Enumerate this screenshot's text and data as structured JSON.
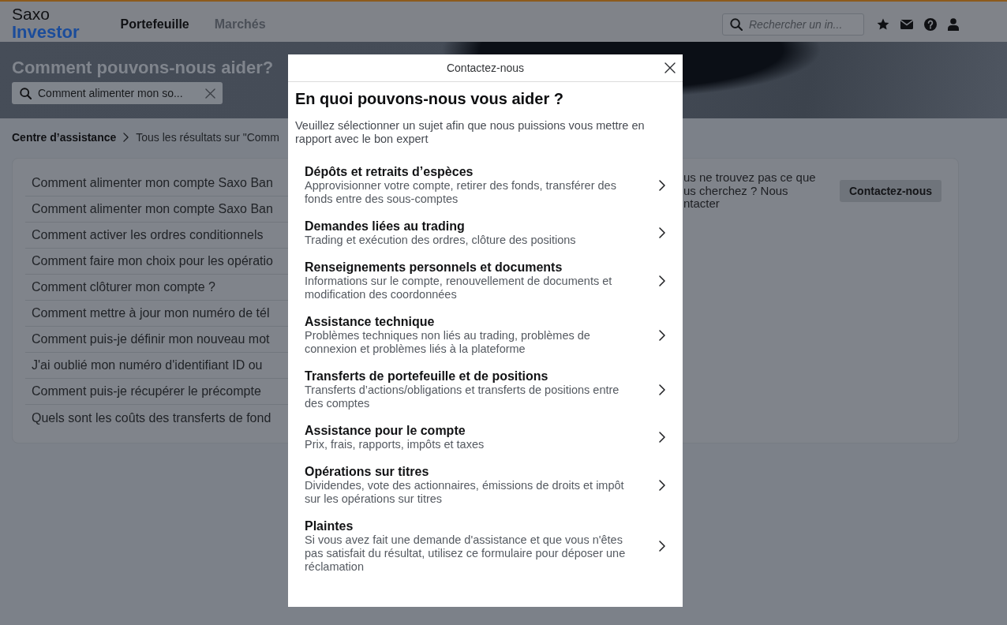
{
  "header": {
    "logo": {
      "line_1": "Saxo",
      "line_2": "Investor"
    },
    "nav": [
      {
        "label": "Portefeuille",
        "selected": true
      },
      {
        "label": "Marchés",
        "selected": false
      }
    ],
    "search": {
      "placeholder": "Rechercher un in..."
    }
  },
  "hero": {
    "title": "Comment pouvons-nous aider?",
    "search": {
      "value": "Comment alimenter mon so..."
    }
  },
  "breadcrumb": [
    {
      "label": "Centre d’assistance",
      "current": false
    },
    {
      "label": "Tous les résultats sur \"Comm",
      "current": true
    }
  ],
  "articles": [
    "Comment alimenter mon compte Saxo Ban",
    "Comment alimenter mon compte Saxo Ban",
    "Comment activer les ordres conditionnels",
    "Comment faire mon choix pour les opératio",
    "Comment clôturer mon compte ?",
    "Comment mettre à jour mon numéro de tél",
    "Comment puis-je définir mon nouveau mot",
    "J'ai oublié mon numéro d'identifiant ID ou",
    "Comment puis-je récupérer le précompte",
    "Quels sont les coûts des transferts de fond"
  ],
  "help_card": {
    "text_lines": [
      "us ne trouvez pas ce que",
      "us cherchez ? Nous",
      "ntacter"
    ],
    "button": "Contactez-nous"
  },
  "dialog": {
    "title": "Contactez-nous",
    "heading": "En quoi pouvons-nous vous aider ?",
    "description": "Veuillez sélectionner un sujet afin que nous puissions vous mettre en rapport avec le bon expert",
    "topics": [
      {
        "title": "Dépôts et retraits d’espèces",
        "description": "Approvisionner votre compte, retirer des fonds, transférer des fonds entre des sous-comptes"
      },
      {
        "title": "Demandes liées au trading",
        "description": "Trading et exécution des ordres, clôture des positions"
      },
      {
        "title": "Renseignements personnels et documents",
        "description": "Informations sur le compte, renouvellement de documents et modification des coordonnées"
      },
      {
        "title": "Assistance technique",
        "description": "Problèmes techniques non liés au trading, problèmes de connexion et problèmes liés à la plateforme"
      },
      {
        "title": "Transferts de portefeuille et de positions",
        "description": "Transferts d’actions/obligations et transferts de positions entre des comptes"
      },
      {
        "title": "Assistance pour le compte",
        "description": "Prix, frais, rapports, impôts et taxes"
      },
      {
        "title": "Opérations sur titres",
        "description": "Dividendes, vote des actionnaires, émissions de droits et impôt sur les opérations sur titres"
      },
      {
        "title": "Plaintes",
        "description": "Si vous avez fait une demande d'assistance et que vous n'êtes pas satisfait du résultat, utilisez ce formulaire pour déposer une réclamation"
      }
    ]
  }
}
